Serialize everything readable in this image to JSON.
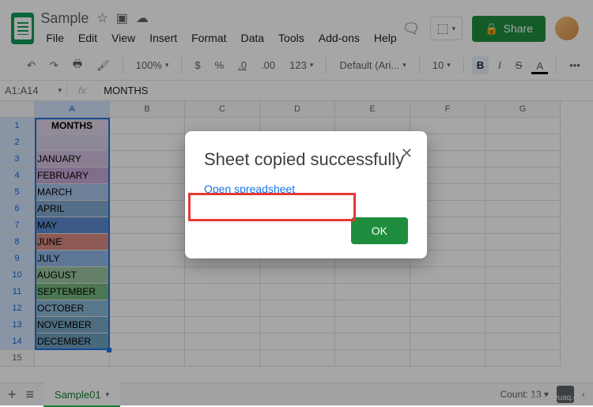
{
  "doc": {
    "title": "Sample"
  },
  "menubar": [
    "File",
    "Edit",
    "View",
    "Insert",
    "Format",
    "Data",
    "Tools",
    "Add-ons",
    "Help"
  ],
  "header": {
    "share": "Share"
  },
  "toolbar": {
    "zoom": "100%",
    "currency": "$",
    "percent": "%",
    "dec_dec": ".0",
    "inc_dec": ".00",
    "num_format": "123",
    "font": "Default (Ari...",
    "size": "10",
    "bold": "B",
    "italic": "I",
    "strike": "S",
    "text_color": "A",
    "more": "•••"
  },
  "formula": {
    "range": "A1:A14",
    "fx": "fx",
    "value": "MONTHS"
  },
  "columns": [
    "A",
    "B",
    "C",
    "D",
    "E",
    "F",
    "G"
  ],
  "rows_header": "MONTHS",
  "months": [
    "JANUARY",
    "FEBRUARY",
    "MARCH",
    "APRIL",
    "MAY",
    "JUNE",
    "JULY",
    "AUGUST",
    "SEPTEMBER",
    "OCTOBER",
    "NOVEMBER",
    "DECEMBER"
  ],
  "row_colors": [
    "#e1d5e7",
    "#d9d2e9",
    "#d5c2e0",
    "#c7a8d8",
    "#a7c5e8",
    "#82a9d0",
    "#5b8bd0",
    "#d98b82",
    "#8fb9e8",
    "#9cc5a0",
    "#74b77e",
    "#8bb8d6",
    "#79a8c5",
    "#6fa0bd"
  ],
  "sheet_tabs": {
    "active": "Sample01"
  },
  "status": {
    "count_label": "Count:",
    "count_val": "13"
  },
  "dialog": {
    "title": "Sheet copied successfully",
    "link": "Open spreadsheet",
    "ok": "OK"
  },
  "watermark": "www.deuaq.com"
}
